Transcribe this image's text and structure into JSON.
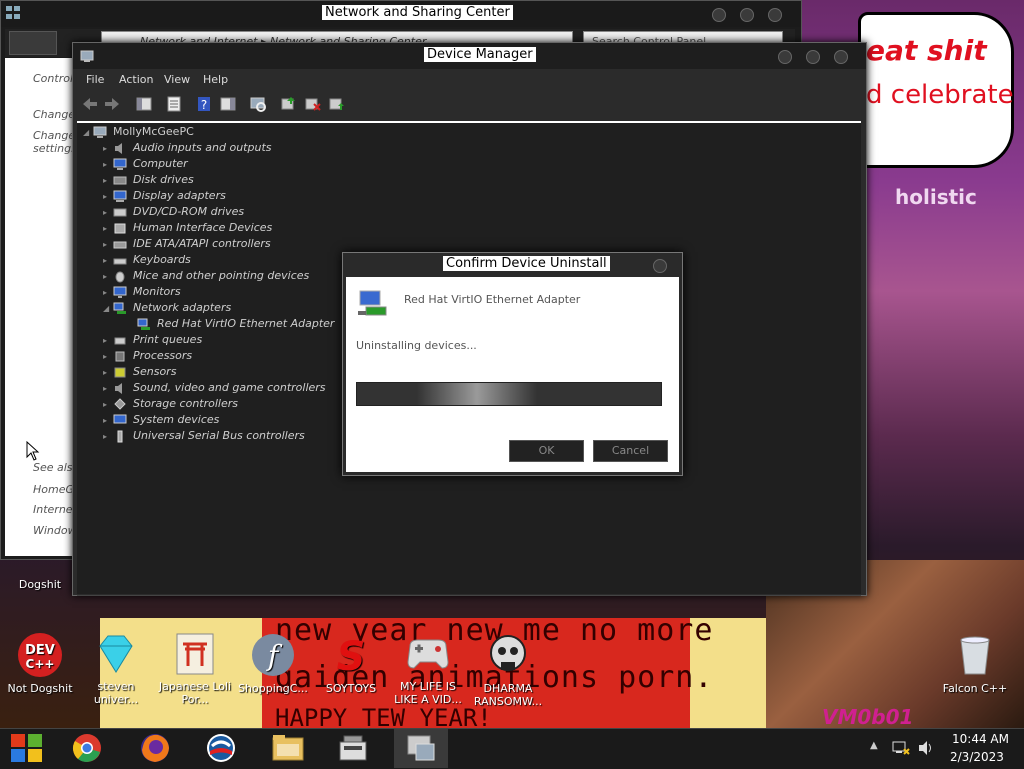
{
  "wallpaper": {
    "text_line1": "eat shit",
    "text_line2": "d celebrate",
    "text_line3": "holistic",
    "red_banner_line1": "new year new me no more",
    "red_banner_line2": "gaiden animations porn.",
    "red_banner_line3": "HAPPY TEW YEAR!",
    "stamp": "VM0b01"
  },
  "network_window": {
    "title": "Network and Sharing Center",
    "breadcrumb": "Network and Internet  ▸  Network and Sharing Center",
    "search_placeholder": "Search Control Panel",
    "left_links": [
      "Control",
      "Change",
      "Change",
      "settings"
    ],
    "see_also": "See also",
    "see_links": [
      "HomeG",
      "Internet",
      "Window"
    ]
  },
  "device_manager": {
    "title": "Device Manager",
    "menu": [
      "File",
      "Action",
      "View",
      "Help"
    ],
    "root": "MollyMcGeePC",
    "categories": [
      "Audio inputs and outputs",
      "Computer",
      "Disk drives",
      "Display adapters",
      "DVD/CD-ROM drives",
      "Human Interface Devices",
      "IDE ATA/ATAPI controllers",
      "Keyboards",
      "Mice and other pointing devices",
      "Monitors",
      "Network adapters",
      "Red Hat VirtIO Ethernet Adapter",
      "Print queues",
      "Processors",
      "Sensors",
      "Sound, video and game controllers",
      "Storage controllers",
      "System devices",
      "Universal Serial Bus controllers"
    ]
  },
  "dialog": {
    "title": "Confirm Device Uninstall",
    "device_name": "Red Hat VirtIO Ethernet Adapter",
    "status": "Uninstalling devices...",
    "ok_label": "OK",
    "cancel_label": "Cancel"
  },
  "desktop_icons": [
    {
      "label": "Dogshit"
    },
    {
      "label": "Not Dogshit"
    },
    {
      "label": "steven univer..."
    },
    {
      "label": "Japanese Loli Por..."
    },
    {
      "label": "ShoppingC..."
    },
    {
      "label": "SOYTOYS"
    },
    {
      "label": "MY LIFE IS LIKE A VID..."
    },
    {
      "label": "DHARMA RANSOMW..."
    },
    {
      "label": "Falcon C++"
    }
  ],
  "taskbar": {
    "time": "10:44 AM",
    "date": "2/3/2023"
  }
}
